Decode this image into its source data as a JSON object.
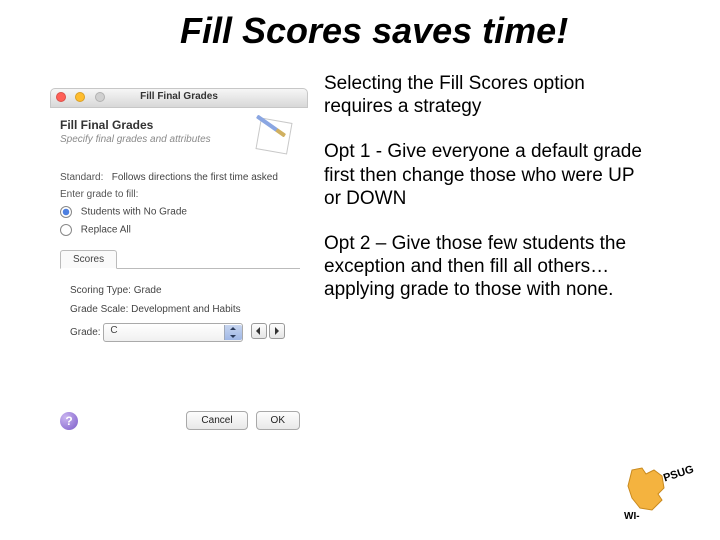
{
  "title": "Fill Scores saves time!",
  "bullets": [
    "Selecting the Fill Scores option requires a strategy",
    "Opt 1 - Give everyone a default grade first then change those who were UP or DOWN",
    "Opt 2 – Give those few students the exception and then fill all others… applying grade to those with none."
  ],
  "dialog": {
    "window_title": "Fill Final Grades",
    "header_title": "Fill Final Grades",
    "header_sub": "Specify final grades and attributes",
    "standard_label": "Standard:",
    "standard_value": "Follows directions the first time asked",
    "fill_label": "Enter grade to fill:",
    "radios": [
      "Students with No Grade",
      "Replace All"
    ],
    "tab": "Scores",
    "rows": {
      "scoring_type_label": "Scoring Type:",
      "scoring_type_value": "Grade",
      "grade_scale_label": "Grade Scale:",
      "grade_scale_value": "Development and Habits",
      "grade_label": "Grade:",
      "grade_value": "C"
    },
    "buttons": {
      "help": "?",
      "cancel": "Cancel",
      "ok": "OK"
    }
  },
  "logo": {
    "wi": "WI-",
    "psug": "PSUG"
  }
}
